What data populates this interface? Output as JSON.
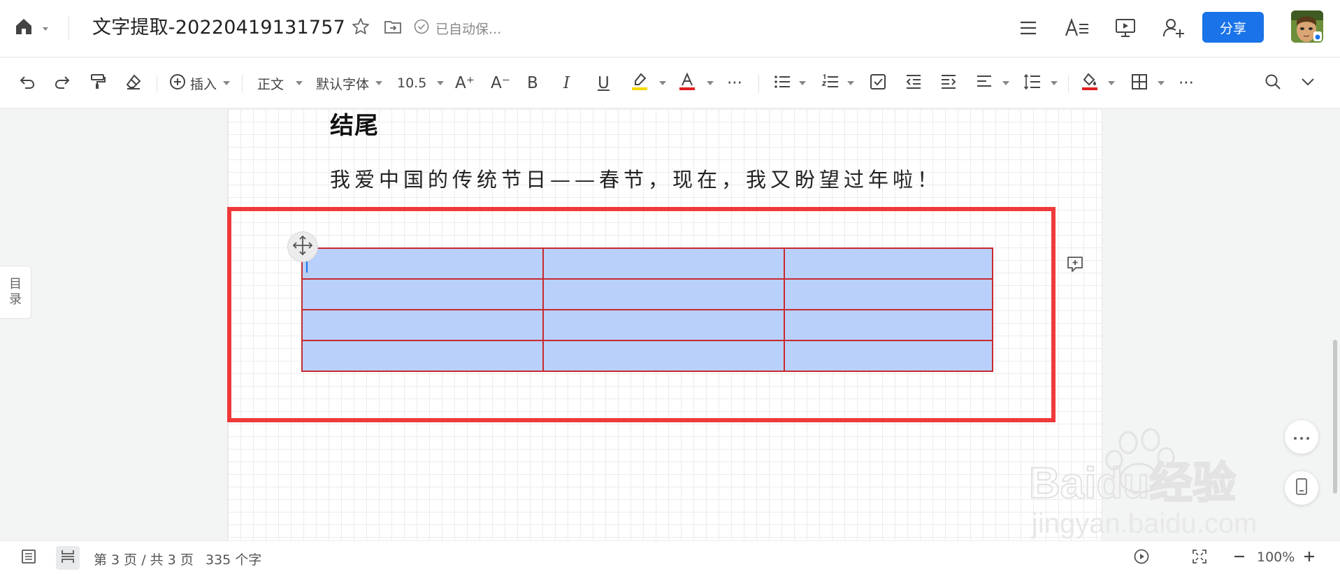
{
  "header": {
    "title": "文字提取-20220419131757",
    "saved_status": "已自动保...",
    "share_label": "分享"
  },
  "toolbar": {
    "insert_label": "插入",
    "style_label": "正文",
    "font_label": "默认字体",
    "size_label": "10.5",
    "increase_font": "A⁺",
    "decrease_font": "A⁻",
    "bold": "B",
    "italic": "I",
    "underline": "U",
    "more": "···"
  },
  "document": {
    "heading": "结尾",
    "paragraph": "我爱中国的传统节日——春节，现在，我又盼望过年啦！",
    "table": {
      "rows": 4,
      "cols": 3
    }
  },
  "sidebar": {
    "toc_line1": "目",
    "toc_line2": "录"
  },
  "watermark": {
    "brand": "Baidu经验",
    "url": "jingyan.baidu.com"
  },
  "status": {
    "page_info": "第 3 页 / 共 3 页",
    "word_count": "335 个字",
    "zoom": "100%"
  },
  "colors": {
    "accent": "#1a73e8",
    "highlight_border": "#f0393a",
    "table_border": "#c72a2f",
    "cell_fill": "#b9d0fb",
    "highlight_yellow": "#f5d800",
    "text_red": "#e02020"
  },
  "icons": [
    "home-icon",
    "star-icon",
    "move-to-folder-icon",
    "check-circle-icon",
    "list-icon",
    "text-format-icon",
    "present-icon",
    "add-user-icon",
    "undo-icon",
    "redo-icon",
    "format-painter-icon",
    "eraser-icon",
    "plus-circle-icon",
    "highlight-icon",
    "font-color-icon",
    "bullet-list-icon",
    "numbered-list-icon",
    "checklist-icon",
    "outdent-icon",
    "indent-icon",
    "align-icon",
    "line-spacing-icon",
    "fill-color-icon",
    "table-icon",
    "search-icon",
    "chevron-down-icon",
    "move-handle-icon",
    "add-comment-icon",
    "more-icon",
    "mobile-icon",
    "outline-icon",
    "page-view-icon",
    "play-icon",
    "fullscreen-icon",
    "zoom-out-icon",
    "zoom-in-icon"
  ]
}
